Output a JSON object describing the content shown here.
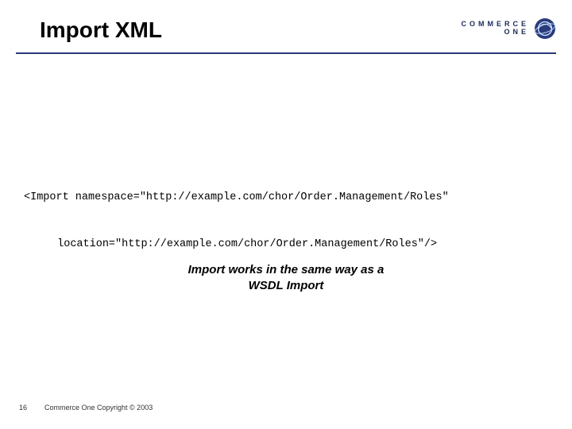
{
  "header": {
    "title": "Import XML",
    "logo": {
      "line1": "COMMERCE",
      "line2": "ONE"
    }
  },
  "code": {
    "line1": "<Import namespace=\"http://example.com/chor/Order.Management/Roles\"",
    "line2": "location=\"http://example.com/chor/Order.Management/Roles\"/>"
  },
  "note": {
    "line1": "Import works in the same way as a",
    "line2": "WSDL Import"
  },
  "footer": {
    "page": "16",
    "copyright": "Commerce One Copyright © 2003"
  }
}
